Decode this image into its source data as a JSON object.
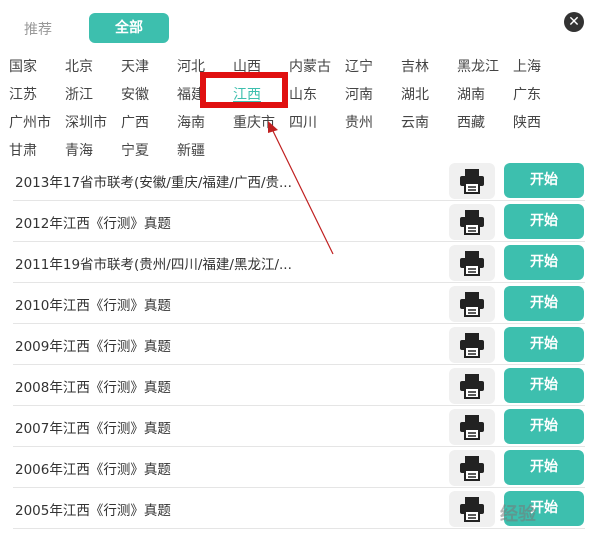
{
  "tabs": {
    "recommended": "推荐",
    "all": "全部"
  },
  "close_label": "✕",
  "provinces": [
    [
      "国家",
      "北京",
      "天津",
      "河北",
      "山西",
      "内蒙古",
      "辽宁",
      "吉林",
      "黑龙江",
      "上海"
    ],
    [
      "江苏",
      "浙江",
      "安徽",
      "福建",
      "江西",
      "山东",
      "河南",
      "湖北",
      "湖南",
      "广东"
    ],
    [
      "广州市",
      "深圳市",
      "广西",
      "海南",
      "重庆市",
      "四川",
      "贵州",
      "云南",
      "西藏",
      "陕西"
    ],
    [
      "甘肃",
      "青海",
      "宁夏",
      "新疆"
    ]
  ],
  "selected_province": "江西",
  "exams": [
    {
      "title": "2013年17省市联考(安徽/重庆/福建/广西/贵...",
      "start": "开始"
    },
    {
      "title": "2012年江西《行测》真题",
      "start": "开始"
    },
    {
      "title": "2011年19省市联考(贵州/四川/福建/黑龙江/...",
      "start": "开始"
    },
    {
      "title": "2010年江西《行测》真题",
      "start": "开始"
    },
    {
      "title": "2009年江西《行测》真题",
      "start": "开始"
    },
    {
      "title": "2008年江西《行测》真题",
      "start": "开始"
    },
    {
      "title": "2007年江西《行测》真题",
      "start": "开始"
    },
    {
      "title": "2006年江西《行测》真题",
      "start": "开始"
    },
    {
      "title": "2005年江西《行测》真题",
      "start": "开始"
    }
  ],
  "watermark": "经验",
  "colors": {
    "accent": "#3dbfae",
    "highlight": "#e01010"
  }
}
